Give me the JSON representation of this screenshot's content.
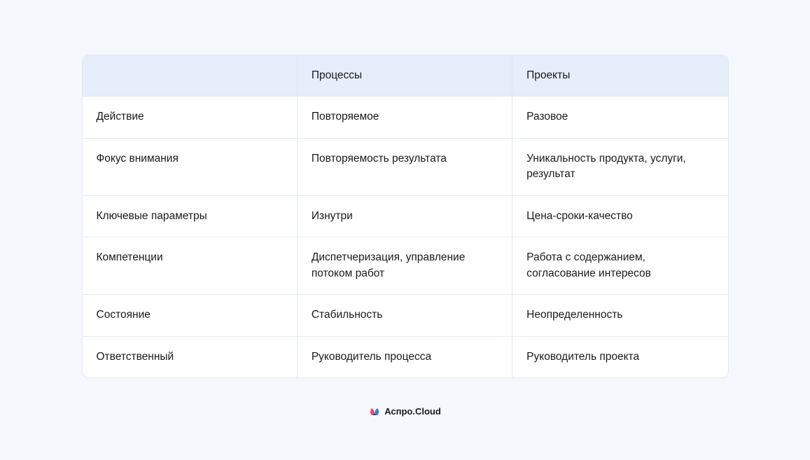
{
  "table": {
    "headers": {
      "col_a": "",
      "col_b": "Процессы",
      "col_c": "Проекты"
    },
    "rows": [
      {
        "a": "Действие",
        "b": "Повторяемое",
        "c": "Разовое"
      },
      {
        "a": "Фокус внимания",
        "b": "Повторяемость результата",
        "c": "Уникальность продукта, услуги, результат"
      },
      {
        "a": "Ключевые параметры",
        "b": "Изнутри",
        "c": "Цена-сроки-качество"
      },
      {
        "a": "Компетенции",
        "b": "Диспетчеризация, управление потоком работ",
        "c": "Работа с содержанием, согласование интересов"
      },
      {
        "a": "Состояние",
        "b": "Стабильность",
        "c": "Неопределенность"
      },
      {
        "a": "Ответственный",
        "b": "Руководитель процесса",
        "c": "Руководитель проекта"
      }
    ]
  },
  "brand": {
    "label": "Аспро.Cloud"
  }
}
